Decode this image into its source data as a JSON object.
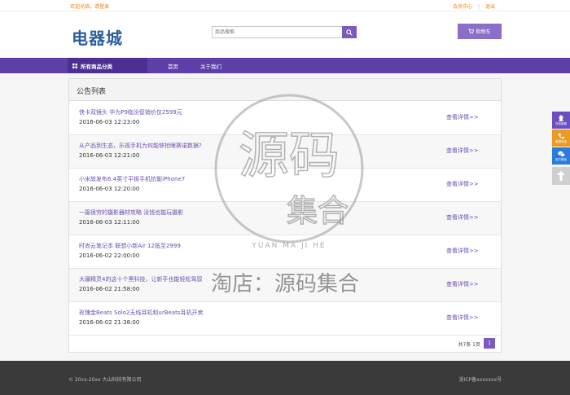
{
  "topbar": {
    "welcome": "欢迎光临，请登录",
    "member": "会员中心",
    "logout": "退出"
  },
  "header": {
    "logo": "电器城",
    "search_placeholder": "商品搜索",
    "cart_label": "购物车"
  },
  "nav": {
    "category": "所有商品分类",
    "items": [
      "首页",
      "关于我们"
    ]
  },
  "panel": {
    "title": "公告列表",
    "more_label": "查看详情>>",
    "rows": [
      {
        "title": "侠卡双镜头 华为P9临汾促销价仅2599元",
        "date": "2016-06-03 12:23:00"
      },
      {
        "title": "从产品到生态，乐视手机为何能够抢眼赛诺数据?",
        "date": "2016-06-03 12:21:00"
      },
      {
        "title": "小米故发布6.4英寸平板手机抗衡iPhone7",
        "date": "2016-06-03 12:20:00"
      },
      {
        "title": "一篇很穷的摄影器材攻略 没钱也能玩摄影",
        "date": "2016-06-03 12:11:00"
      },
      {
        "title": "时尚云笔记本 联想小新Air 12抵至2999",
        "date": "2016-06-02 22:00:00"
      },
      {
        "title": "大疆精灵4的这十个黑科技，让新手也能轻松驾驭",
        "date": "2016-06-02 21:58:00"
      },
      {
        "title": "玫瑰金Beats Solo2无线耳机和urBeats耳机开卖",
        "date": "2016-06-02 21:38:00"
      }
    ]
  },
  "pager": {
    "info": "共7条 1页",
    "current": "1"
  },
  "footer": {
    "copyright": "© 20xx-20xx 大山科技有限公司",
    "icp": "浙ICP备xxxxxxx号"
  },
  "sidebar": {
    "qq": "在线客服",
    "phone": "客服电话",
    "wechat": "官方微信"
  },
  "watermark": {
    "line1": "源码",
    "line2": "集合",
    "pinyin": "YUAN MA JI HE",
    "shop": "淘店：源码集合"
  },
  "colors": {
    "brand": "#5d3fa8",
    "accent": "#7a5cbf",
    "link": "#6b4eb3",
    "welcome": "#e8850c"
  }
}
